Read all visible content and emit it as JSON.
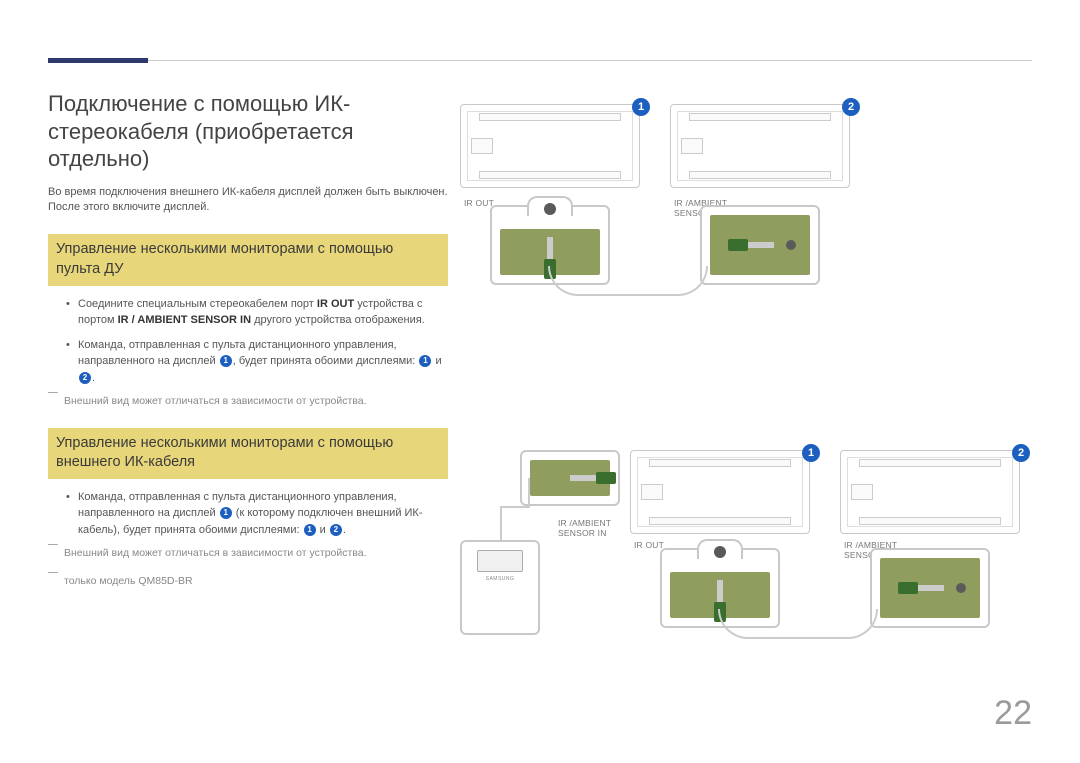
{
  "page_number": "22",
  "heading": "Подключение с помощью ИК-стереокабеля (приобретается отдельно)",
  "intro": "Во время подключения внешнего ИК-кабеля дисплей должен быть выключен. После этого включите дисплей.",
  "section1": {
    "title": "Управление несколькими мониторами с помощью пульта ДУ",
    "bullet1_a": "Соедините специальным стереокабелем порт ",
    "bullet1_b": " устройства с портом ",
    "bullet1_c": " другого устройства отображения.",
    "ir_out": "IR OUT",
    "ir_in": "IR / AMBIENT SENSOR IN",
    "bullet2_a": "Команда, отправленная с пульта дистанционного управления, направленного на дисплей ",
    "bullet2_b": ", будет принята обоими дисплеями: ",
    "bullet2_c": " и ",
    "bullet2_d": ".",
    "note": "Внешний вид может отличаться в зависимости от устройства."
  },
  "section2": {
    "title": "Управление несколькими мониторами с помощью внешнего ИК-кабеля",
    "bullet1_a": "Команда, отправленная с пульта дистанционного управления, направленного на дисплей ",
    "bullet1_b": " (к которому подключен внешний ИК-кабель), будет принята обоими дисплеями: ",
    "bullet1_c": " и ",
    "bullet1_d": ".",
    "note1": "Внешний вид может отличаться в зависимости от устройства.",
    "note2": "только модель QM85D-BR"
  },
  "labels": {
    "ir_out": "IR OUT",
    "ir_ambient_sensor_in": "IR /AMBIENT SENSOR IN",
    "brand": "SAMSUNG"
  },
  "badges": {
    "one": "1",
    "two": "2"
  }
}
